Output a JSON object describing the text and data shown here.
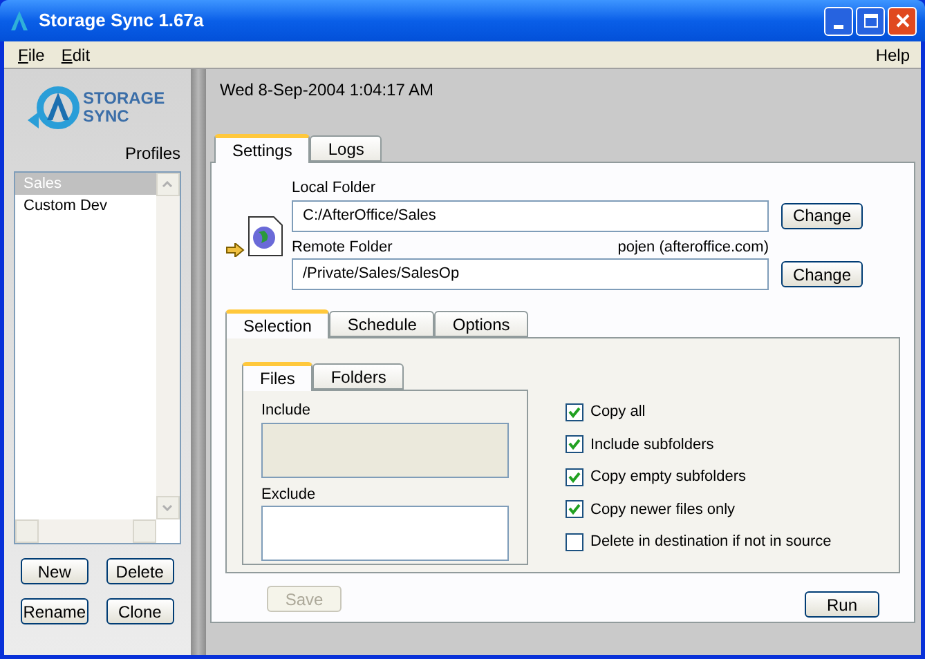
{
  "window": {
    "title": "Storage Sync 1.67a"
  },
  "menu": [
    {
      "label": "File"
    },
    {
      "label": "Edit"
    }
  ],
  "help": "Help",
  "logo": {
    "line1": "STORAGE",
    "line2": "SYNC"
  },
  "profiles": {
    "label": "Profiles",
    "items": [
      {
        "label": "Sales",
        "selected": true
      },
      {
        "label": "Custom Dev",
        "selected": false
      }
    ],
    "buttons": [
      "New",
      "Delete",
      "Rename",
      "Clone"
    ]
  },
  "timestamp": "Wed 8-Sep-2004 1:04:17 AM",
  "tabs": [
    {
      "label": "Settings",
      "selected": true
    },
    {
      "label": "Logs",
      "selected": false
    }
  ],
  "local_folder": {
    "label": "Local Folder",
    "value": "C:/AfterOffice/Sales",
    "button": "Change"
  },
  "remote_folder": {
    "label": "Remote Folder",
    "account": "pojen (afteroffice.com)",
    "value": "/Private/Sales/SalesOp",
    "button": "Change"
  },
  "sub_tabs": [
    {
      "label": "Selection",
      "selected": true
    },
    {
      "label": "Schedule",
      "selected": false
    },
    {
      "label": "Options",
      "selected": false
    }
  ],
  "inner_tabs": [
    {
      "label": "Files",
      "selected": true
    },
    {
      "label": "Folders",
      "selected": false
    }
  ],
  "include": {
    "label": "Include",
    "disabled": true
  },
  "exclude": {
    "label": "Exclude",
    "disabled": false
  },
  "options": [
    {
      "label": "Copy all",
      "checked": true
    },
    {
      "label": "Include subfolders",
      "checked": true
    },
    {
      "label": "Copy empty subfolders",
      "checked": true
    },
    {
      "label": "Copy newer files only",
      "checked": true
    },
    {
      "label": "Delete in destination if not in source",
      "checked": false
    }
  ],
  "save": {
    "label": "Save",
    "disabled": true
  },
  "run": {
    "label": "Run",
    "disabled": false
  }
}
